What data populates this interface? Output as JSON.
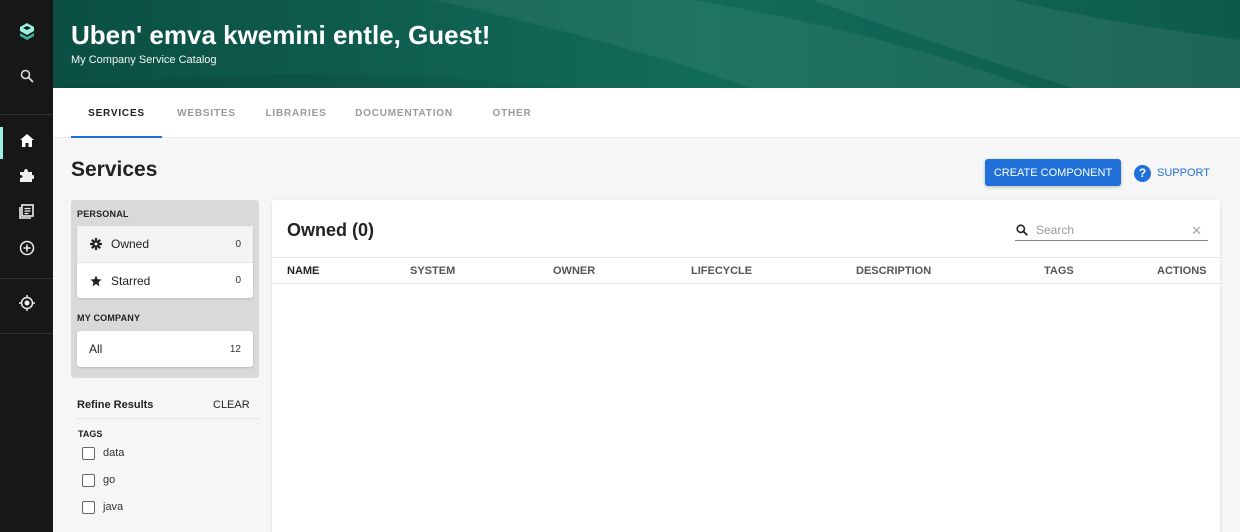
{
  "header": {
    "title": "Uben' emva kwemini entle, Guest!",
    "subtitle": "My Company Service Catalog"
  },
  "nav": {
    "items": [
      {
        "icon": "home-icon",
        "active": true
      },
      {
        "icon": "puzzle-icon"
      },
      {
        "icon": "docs-icon"
      },
      {
        "icon": "create-icon"
      },
      {
        "icon": "radar-icon"
      }
    ]
  },
  "tabs": [
    {
      "label": "SERVICES",
      "active": true
    },
    {
      "label": "WEBSITES"
    },
    {
      "label": "LIBRARIES"
    },
    {
      "label": "DOCUMENTATION"
    },
    {
      "label": "OTHER"
    }
  ],
  "page": {
    "title": "Services",
    "create_label": "CREATE COMPONENT",
    "support_label": "SUPPORT"
  },
  "filters": {
    "personal_label": "PERSONAL",
    "personal": [
      {
        "label": "Owned",
        "count": "0",
        "icon": "gear-icon",
        "selected": true
      },
      {
        "label": "Starred",
        "count": "0",
        "icon": "star-icon"
      }
    ],
    "company_label": "MY COMPANY",
    "company": [
      {
        "label": "All",
        "count": "12"
      }
    ],
    "refine_label": "Refine Results",
    "clear_label": "CLEAR",
    "tags_label": "TAGS",
    "tags": [
      "data",
      "go",
      "java"
    ]
  },
  "table": {
    "title": "Owned (0)",
    "search_placeholder": "Search",
    "columns": [
      "NAME",
      "SYSTEM",
      "OWNER",
      "LIFECYCLE",
      "DESCRIPTION",
      "TAGS",
      "ACTIONS"
    ]
  },
  "colors": {
    "accent": "#1f70d8",
    "banner": "#126c5a",
    "rail": "#171717"
  }
}
